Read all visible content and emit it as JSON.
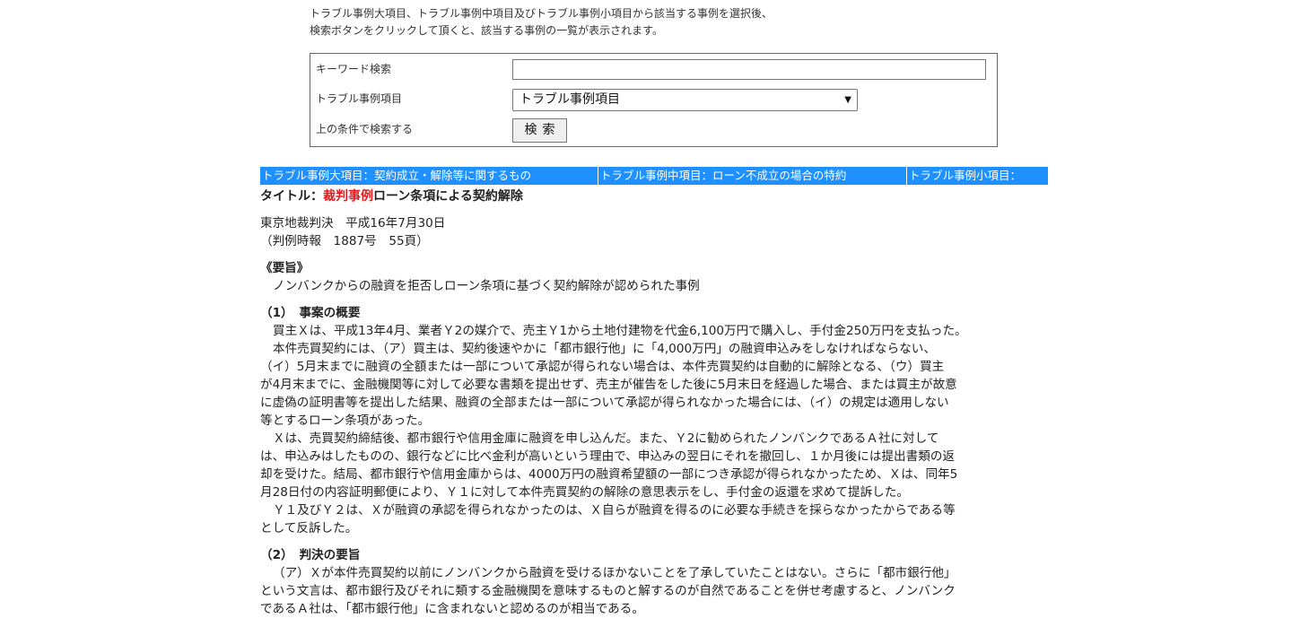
{
  "intro": {
    "line1": "トラブル事例大項目、トラブル事例中項目及びトラブル事例小項目から該当する事例を選択後、",
    "line2": "検索ボタンをクリックして頂くと、該当する事例の一覧が表示されます。"
  },
  "search": {
    "keyword_label": "キーワード検索",
    "keyword_value": "",
    "category_label": "トラブル事例項目",
    "category_selected": "トラブル事例項目",
    "submit_label": "上の条件で検索する",
    "button_label": "検索"
  },
  "categories": {
    "large": "トラブル事例大項目：契約成立・解除等に関するもの",
    "medium": "トラブル事例中項目：ローン不成立の場合の特約",
    "small": "トラブル事例小項目："
  },
  "article": {
    "title_prefix": "タイトル：",
    "title_tag": "裁判事例",
    "title_main": "ローン条項による契約解除",
    "court": "東京地裁判決　平成16年7月30日",
    "reference": "（判例時報　1887号　55頁）",
    "summary_heading": "《要旨》",
    "summary_text": "ノンバンクからの融資を拒否しローン条項に基づく契約解除が認められた事例",
    "section1_heading": "（1）　事案の概要",
    "section1_p1": "買主Ｘは、平成13年4月、業者Ｙ2の媒介で、売主Ｙ1から土地付建物を代金6,100万円で購入し、手付金250万円を支払った。",
    "section1_p2a": "本件売買契約には、（ア）買主は、契約後速やかに「都市銀行他」に「4,000万円」の融資申込みをしなければならない、",
    "section1_p2b": "（イ）5月末までに融資の全額または一部について承認が得られない場合は、本件売買契約は自動的に解除となる、（ウ）買主",
    "section1_p2c": "が4月末までに、金融機関等に対して必要な書類を提出せず、売主が催告をした後に5月末日を経過した場合、または買主が故意",
    "section1_p2d": "に虚偽の証明書等を提出した結果、融資の全部または一部について承認が得られなかった場合には、（イ）の規定は適用しない",
    "section1_p2e": "等とするローン条項があった。",
    "section1_p3a": "Ｘは、売買契約締結後、都市銀行や信用金庫に融資を申し込んだ。また、Ｙ2に勧められたノンバンクであるＡ社に対して",
    "section1_p3b": "は、申込みはしたものの、銀行などに比べ金利が高いという理由で、申込みの翌日にそれを撤回し、１か月後には提出書類の返",
    "section1_p3c": "却を受けた。結局、都市銀行や信用金庫からは、4000万円の融資希望額の一部につき承認が得られなかったため、Ｘは、同年5",
    "section1_p3d": "月28日付の内容証明郵便により、Ｙ１に対して本件売買契約の解除の意思表示をし、手付金の返還を求めて提訴した。",
    "section1_p4a": "Ｙ１及びＹ２は、Ｘが融資の承認を得られなかったのは、Ｘ自らが融資を得るのに必要な手続きを採らなかったからである等",
    "section1_p4b": "として反訴した。",
    "section2_heading": "（2）　判決の要旨",
    "section2_p1a": "（ア）Ｘが本件売買契約以前にノンバンクから融資を受けるほかないことを了承していたことはない。さらに「都市銀行他」",
    "section2_p1b": "という文言は、都市銀行及びそれに類する金融機関を意味するものと解するのが自然であることを併せ考慮すると、ノンバンク",
    "section2_p1c": "であるＡ社は、「都市銀行他」に含まれないと認めるのが相当である。"
  },
  "colors": {
    "category_bar": "#1e90ff",
    "title_tag": "#e8161a"
  },
  "icons": {
    "select_arrow": "chevron-down-icon"
  }
}
